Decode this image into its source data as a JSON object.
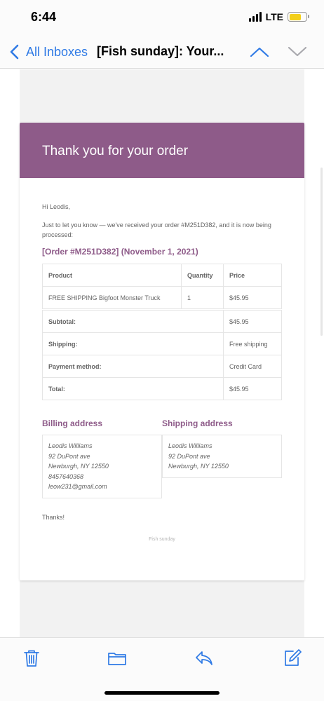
{
  "status": {
    "time": "6:44",
    "network": "LTE"
  },
  "nav": {
    "back_label": "All Inboxes",
    "subject": "[Fish sunday]: Your..."
  },
  "email": {
    "header_title": "Thank you for your order",
    "greeting": "Hi Leodis,",
    "intro": "Just to let you know — we've received your order #M251D382, and it is now being processed:",
    "order_heading": "[Order #M251D382] (November 1, 2021)",
    "table_headers": [
      "Product",
      "Quantity",
      "Price"
    ],
    "items": [
      {
        "product": "FREE SHIPPING Bigfoot Monster Truck",
        "quantity": "1",
        "price": "$45.95"
      }
    ],
    "totals": [
      {
        "label": "Subtotal:",
        "value": "$45.95"
      },
      {
        "label": "Shipping:",
        "value": "Free shipping"
      },
      {
        "label": "Payment method:",
        "value": "Credit Card"
      },
      {
        "label": "Total:",
        "value": "$45.95"
      }
    ],
    "billing": {
      "title": "Billing address",
      "name": "Leodis Williams",
      "street": "92 DuPont ave",
      "city": "Newburgh, NY 12550",
      "phone": "8457640368",
      "email": "leow231@gmail.com"
    },
    "shipping": {
      "title": "Shipping address",
      "name": "Leodis Williams",
      "street": "92 DuPont ave",
      "city": "Newburgh, NY 12550"
    },
    "thanks": "Thanks!",
    "footer": "Fish sunday"
  },
  "colors": {
    "accent": "#8e5b89",
    "ios_blue": "#2f7ae5"
  },
  "icons": {
    "back": "chevron-left-icon",
    "prev": "chevron-up-icon",
    "next": "chevron-down-icon",
    "trash": "trash-icon",
    "folder": "folder-icon",
    "reply": "reply-icon",
    "compose": "compose-icon"
  }
}
